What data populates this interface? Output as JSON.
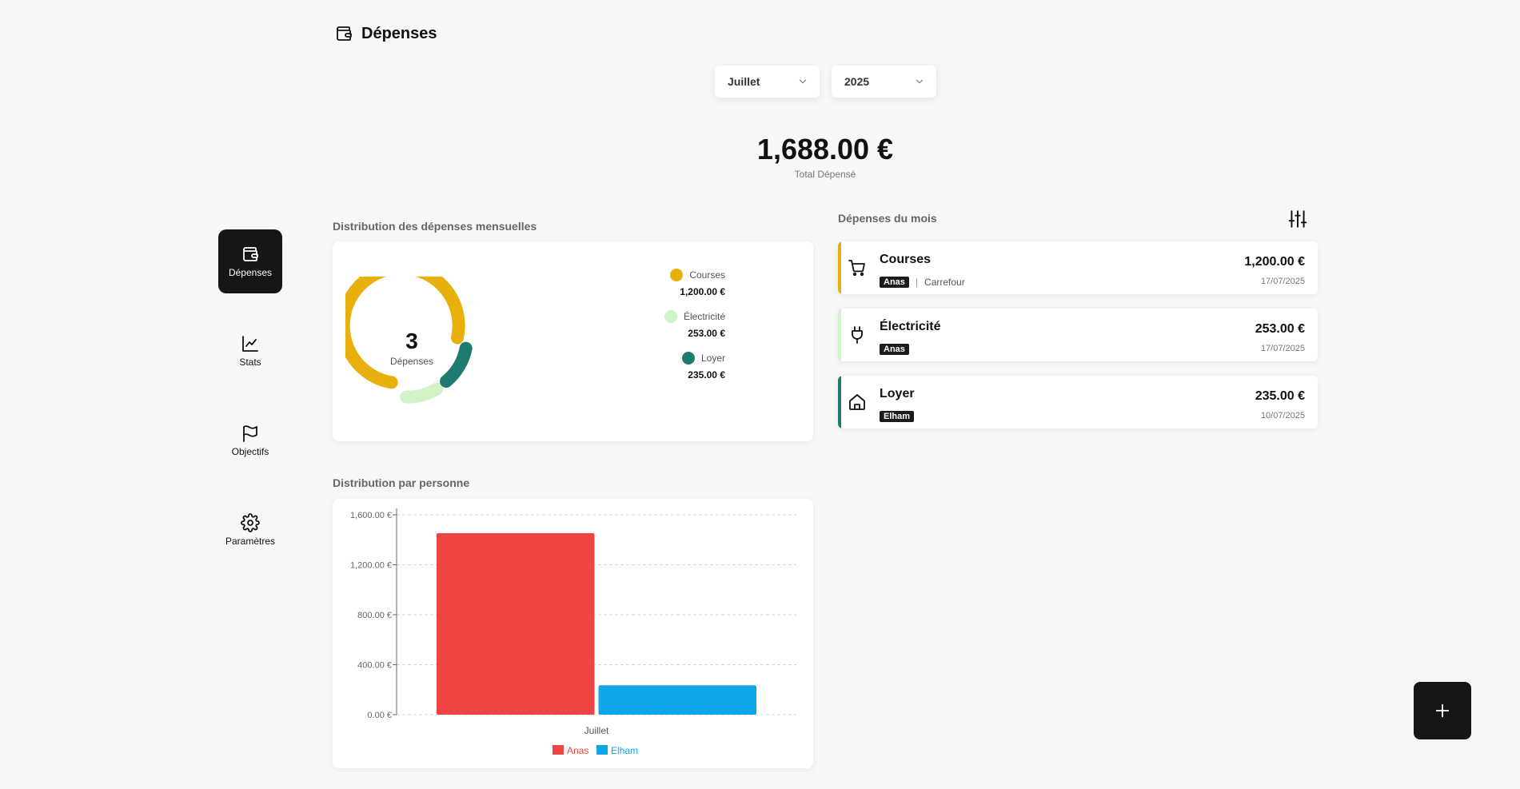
{
  "nav": {
    "expenses": "Dépenses",
    "stats": "Stats",
    "goals": "Objectifs",
    "settings": "Paramètres"
  },
  "header": {
    "title": "Dépenses"
  },
  "filters": {
    "month": "Juillet",
    "year": "2025"
  },
  "total": {
    "value": "1,688.00 €",
    "label": "Total Dépensé"
  },
  "distribution": {
    "title": "Distribution des dépenses mensuelles",
    "count": "3",
    "count_label": "Dépenses",
    "legend": [
      {
        "name": "Courses",
        "amount": "1,200.00 €",
        "color": "#e8b00c"
      },
      {
        "name": "Électricité",
        "amount": "253.00 €",
        "color": "#d2f3c8"
      },
      {
        "name": "Loyer",
        "amount": "235.00 €",
        "color": "#1f7a70"
      }
    ]
  },
  "per_person": {
    "title": "Distribution par personne"
  },
  "chart_data": {
    "type": "bar",
    "categories": [
      "Juillet"
    ],
    "series": [
      {
        "name": "Anas",
        "values": [
          1453
        ],
        "color": "#ef4444"
      },
      {
        "name": "Elham",
        "values": [
          235
        ],
        "color": "#0ea5e9"
      }
    ],
    "ylim": [
      0,
      1600
    ],
    "yticks": [
      "0.00 €",
      "400.00 €",
      "800.00 €",
      "1,200.00 €",
      "1,600.00 €"
    ],
    "xlabel": "",
    "ylabel": "",
    "grid": true,
    "legend": "bottom"
  },
  "month_expenses": {
    "title": "Dépenses du mois",
    "items": [
      {
        "name": "Courses",
        "person": "Anas",
        "store": "Carrefour",
        "sep": "|",
        "amount": "1,200.00 €",
        "date": "17/07/2025",
        "color": "#e8b00c"
      },
      {
        "name": "Électricité",
        "person": "Anas",
        "amount": "253.00 €",
        "date": "17/07/2025",
        "color": "#d2f3c8"
      },
      {
        "name": "Loyer",
        "person": "Elham",
        "amount": "235.00 €",
        "date": "10/07/2025",
        "color": "#1f7a70"
      }
    ]
  },
  "icons": {
    "nav_expenses": "wallet-icon",
    "nav_stats": "line-chart-icon",
    "nav_goals": "flag-icon",
    "nav_settings": "gear-icon",
    "filter": "sliders-icon",
    "add": "plus-icon"
  }
}
